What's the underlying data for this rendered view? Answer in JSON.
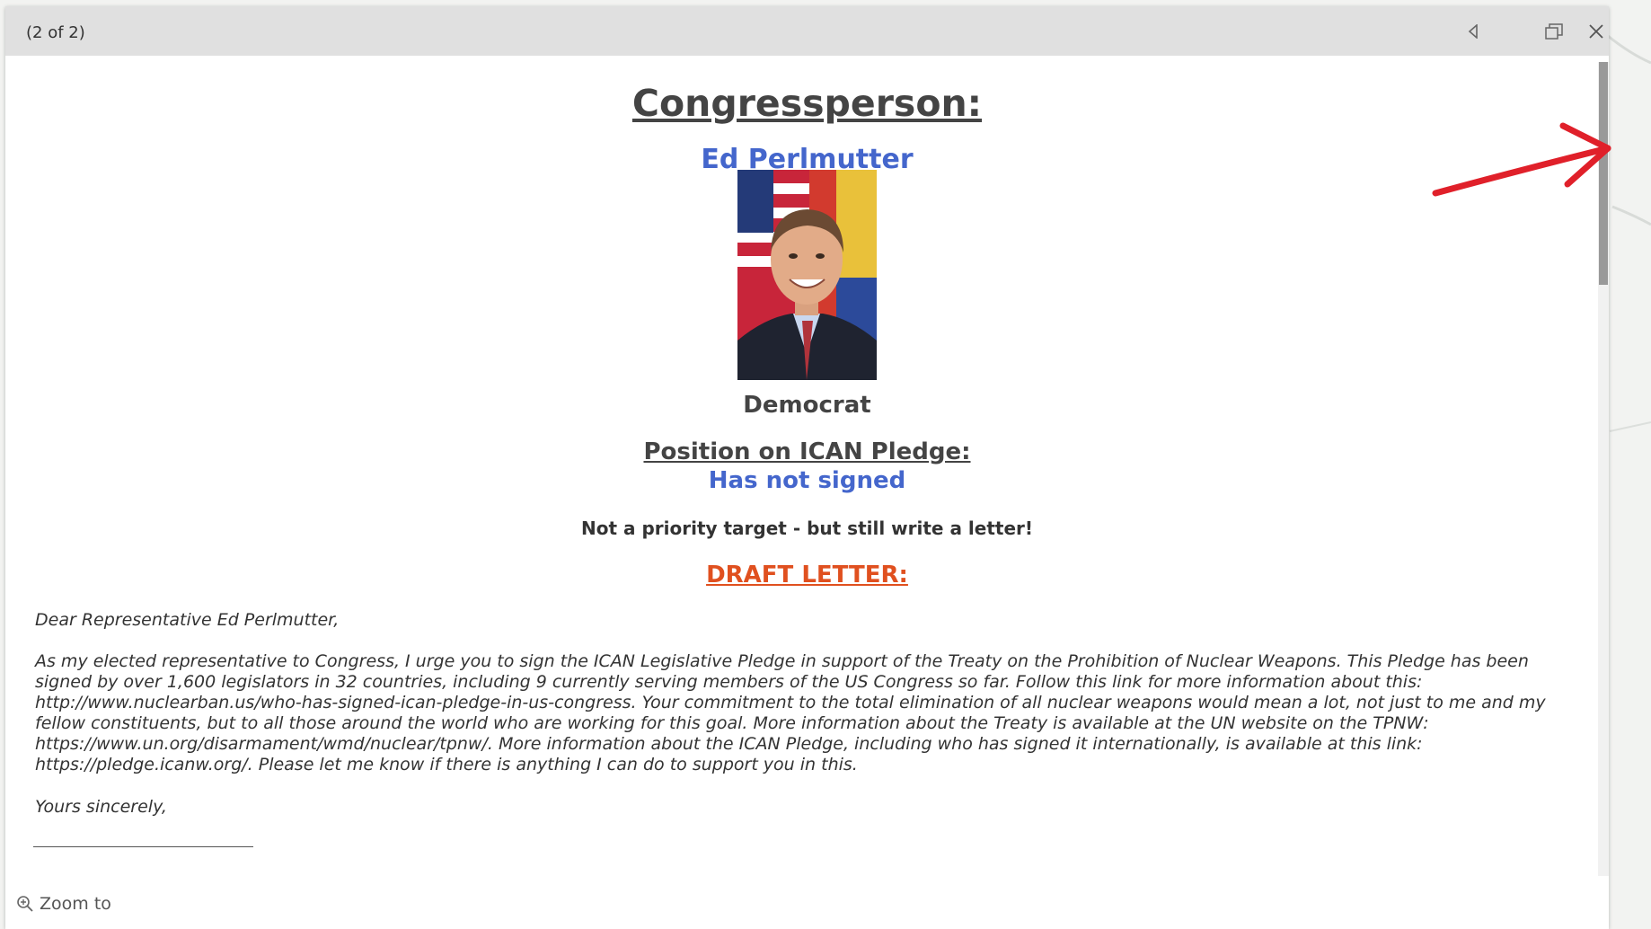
{
  "popup": {
    "counter": "(2 of 2)",
    "buttons": {
      "previous": "previous-icon",
      "dock": "dock-icon",
      "close": "close-icon"
    }
  },
  "content": {
    "title": "Congressperson:",
    "name": "Ed Perlmutter",
    "party": "Democrat",
    "position_label": "Position on ICAN Pledge:",
    "position_value": "Has not signed",
    "priority_note": "Not a priority target - but still write a letter!",
    "draft_heading": "DRAFT LETTER:",
    "letter": {
      "salutation": "Dear Representative Ed Perlmutter,",
      "body": "As my elected representative to Congress, I urge you to sign the ICAN Legislative Pledge in support of the Treaty on the Prohibition of Nuclear Weapons. This Pledge has been signed by over 1,600 legislators in 32 countries, including 9 currently serving members of the US Congress so far. Follow this link for more information about this: http://www.nuclearban.us/who-has-signed-ican-pledge-in-us-congress. Your commitment to the total elimination of all nuclear weapons would mean a lot, not just to me and my fellow constituents, but to all those around the world who are working for this goal. More information about the Treaty is available at the UN website on the TPNW: https://www.un.org/disarmament/wmd/nuclear/tpnw/. More information about the ICAN Pledge, including who has signed it internationally, is available at this link: https://pledge.icanw.org/. Please let me know if there is anything I can do to support you in this.",
      "signoff": "Yours sincerely,"
    }
  },
  "footer": {
    "zoom_label": "Zoom to"
  },
  "colors": {
    "accent_blue": "#4466cc",
    "draft_orange": "#e0501f",
    "annotation_red": "#e0202a"
  }
}
